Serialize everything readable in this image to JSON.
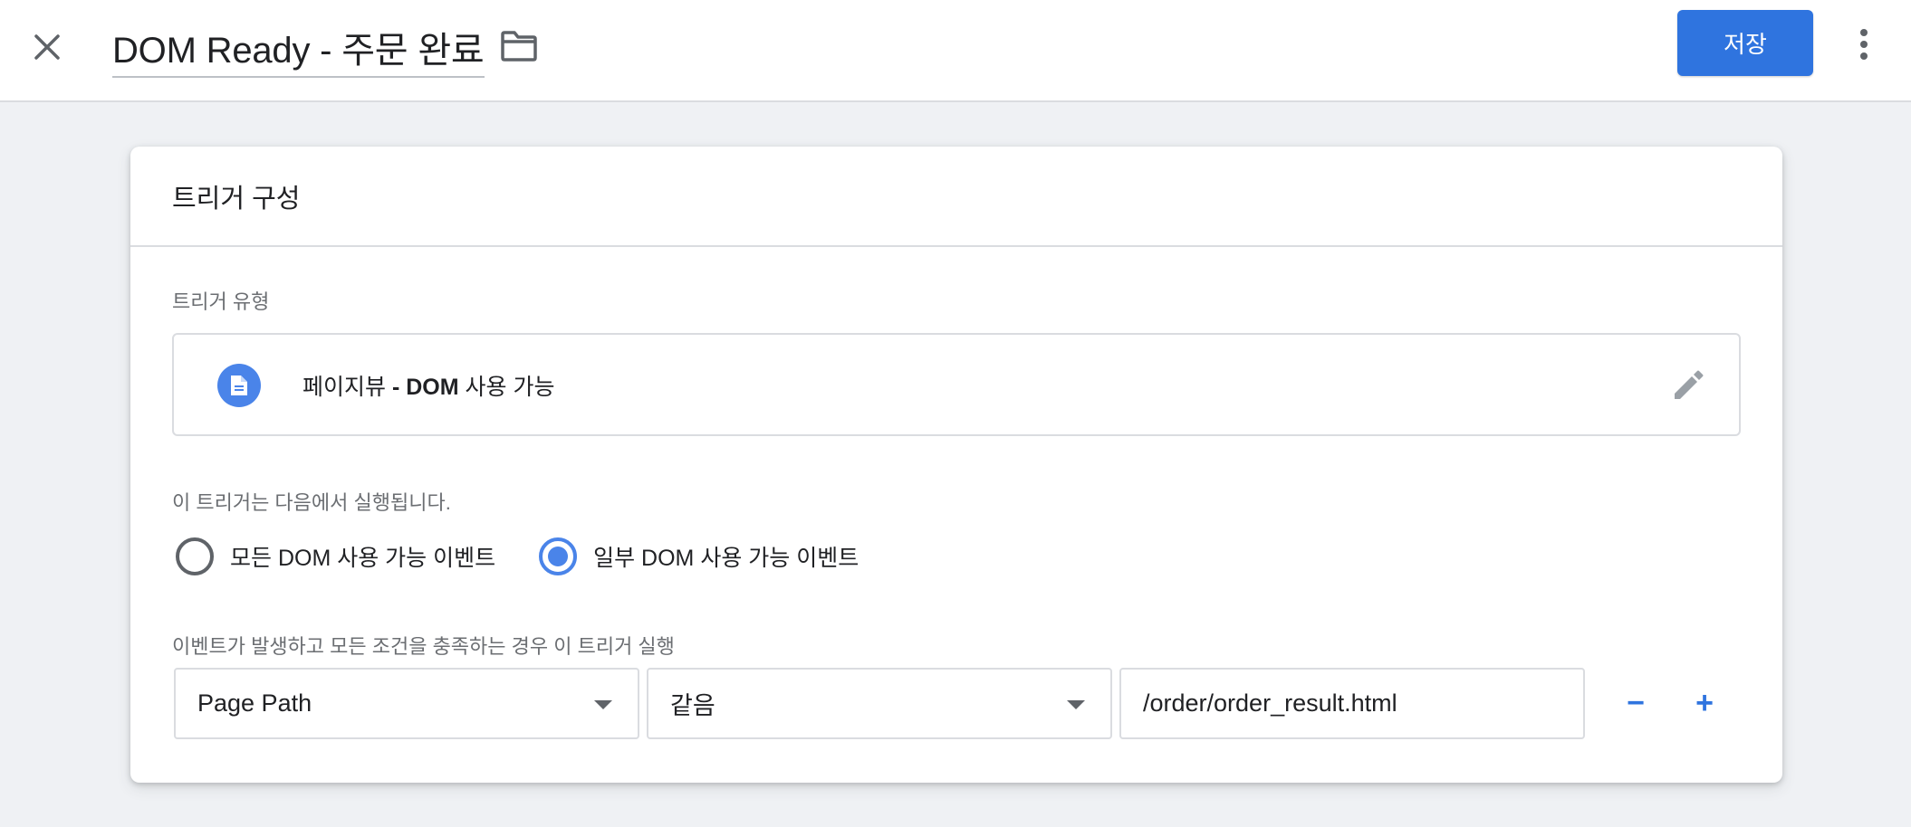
{
  "header": {
    "title": "DOM Ready - 주문 완료",
    "save_label": "저장",
    "close_icon": "close-icon",
    "folder_icon": "folder-icon",
    "more_icon": "more-vert-icon"
  },
  "card": {
    "title": "트리거 구성",
    "trigger_type_label": "트리거 유형",
    "trigger_type": {
      "name_part1": "페이지뷰",
      "name_part2": " - DOM",
      "name_part3": " 사용 가능",
      "icon": "document-icon",
      "edit_icon": "pencil-icon"
    },
    "fires_on_label": "이 트리거는 다음에서 실행됩니다.",
    "fire_options": [
      {
        "label": "모든 DOM 사용 가능 이벤트",
        "selected": false
      },
      {
        "label": "일부 DOM 사용 가능 이벤트",
        "selected": true
      }
    ],
    "condition_label": "이벤트가 발생하고 모든 조건을 충족하는 경우 이 트리거 실행",
    "condition": {
      "variable": "Page Path",
      "operator": "같음",
      "value": "/order/order_result.html"
    },
    "remove_label": "−",
    "add_label": "+"
  },
  "colors": {
    "accent": "#2f74df",
    "radio_selected": "#4a84e9",
    "background": "#eff1f4"
  }
}
